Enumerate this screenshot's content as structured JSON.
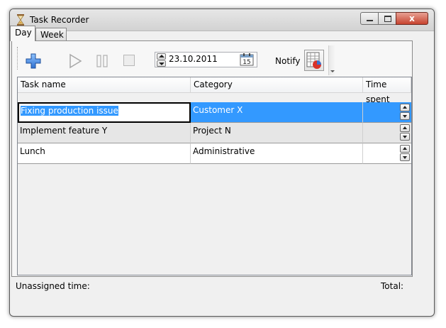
{
  "window": {
    "title": "Task Recorder",
    "close_glyph": "x",
    "app_icon": "hourglass-icon"
  },
  "tabs": [
    {
      "label": "Day",
      "selected": true
    },
    {
      "label": "Week",
      "selected": false
    }
  ],
  "toolbar": {
    "date_value": "23.10.2011",
    "calendar_day": "15",
    "notify_label": "Notify",
    "icons": [
      "add-task-icon",
      "play-icon",
      "pause-icon",
      "stop-icon",
      "calendar-icon",
      "notify-icon"
    ]
  },
  "grid": {
    "columns": [
      "Task name",
      "Category",
      "Time spent"
    ],
    "rows": [
      {
        "task": "Fixing production issue",
        "category": "Customer X",
        "time": ""
      },
      {
        "task": "Implement feature Y",
        "category": "Project N",
        "time": ""
      },
      {
        "task": "Lunch",
        "category": "Administrative",
        "time": ""
      }
    ],
    "selection_color": "#3399ff"
  },
  "status": {
    "unassigned_label": "Unassigned time:",
    "total_label": "Total:"
  }
}
